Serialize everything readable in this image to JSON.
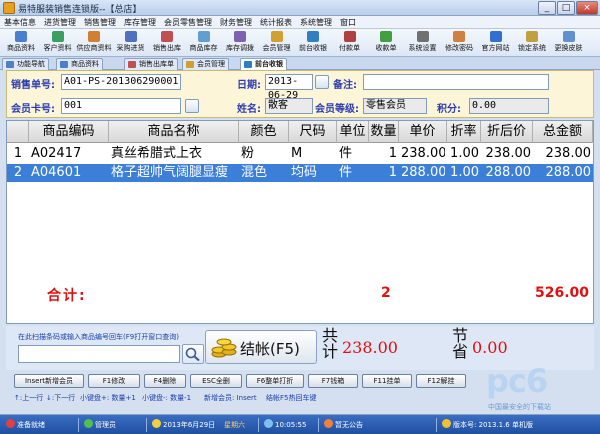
{
  "window": {
    "title": "易特服装销售连锁版--【总店】",
    "min": "_",
    "max": "□",
    "close": "×"
  },
  "menu": [
    "基本信息",
    "进货管理",
    "销售管理",
    "库存管理",
    "会员零售管理",
    "财务管理",
    "统计报表",
    "系统管理",
    "窗口"
  ],
  "toolbar": [
    {
      "label": "商品资料",
      "icon": "product-icon",
      "color": "#4a7fd0"
    },
    {
      "label": "客户资料",
      "icon": "customer-icon",
      "color": "#3aa060"
    },
    {
      "label": "供应商资料",
      "icon": "supplier-icon",
      "color": "#d08030"
    },
    {
      "label": "采购进货",
      "icon": "purchase-icon",
      "color": "#5070c0"
    },
    {
      "label": "销售出库",
      "icon": "sales-out-icon",
      "color": "#c05050"
    },
    {
      "label": "商品库存",
      "icon": "inventory-icon",
      "color": "#60a0d0"
    },
    {
      "label": "库存调拨",
      "icon": "transfer-icon",
      "color": "#8060b0"
    },
    {
      "label": "会员管理",
      "icon": "member-icon",
      "color": "#d0a030"
    },
    {
      "label": "前台收银",
      "icon": "cashier-icon",
      "color": "#3080c0"
    },
    {
      "label": "付款单",
      "icon": "payment-icon",
      "color": "#b04040"
    },
    {
      "label": "收款单",
      "icon": "receipt-icon",
      "color": "#40a040"
    },
    {
      "label": "系统设置",
      "icon": "settings-icon",
      "color": "#707070"
    },
    {
      "label": "修改密码",
      "icon": "password-icon",
      "color": "#d08040"
    },
    {
      "label": "官方网站",
      "icon": "website-icon",
      "color": "#3070d0"
    },
    {
      "label": "锁定系统",
      "icon": "lock-icon",
      "color": "#c0a040"
    },
    {
      "label": "更换皮肤",
      "icon": "skin-icon",
      "color": "#6090d0"
    }
  ],
  "tabs": [
    {
      "label": "功能导航",
      "active": false,
      "color": "#5080c0"
    },
    {
      "label": "商品资料",
      "active": false,
      "color": "#4a7fd0"
    },
    {
      "label": "销售出库单",
      "active": false,
      "color": "#c05050"
    },
    {
      "label": "会员管理",
      "active": false,
      "color": "#d0a030"
    },
    {
      "label": "前台收银",
      "active": true,
      "color": "#3080c0"
    }
  ],
  "form": {
    "order_no_label": "销售单号:",
    "order_no": "A01-PS-201306290001",
    "date_label": "日期:",
    "date": "2013-06-29",
    "remark_label": "备注:",
    "remark": "",
    "member_no_label": "会员卡号:",
    "member_no": "001",
    "name_label": "姓名:",
    "name": "散客",
    "level_label": "会员等级:",
    "level": "零售会员",
    "points_label": "积分:",
    "points": "0.00"
  },
  "grid": {
    "headers": [
      "商品编码",
      "商品名称",
      "颜色",
      "尺码",
      "单位",
      "数量",
      "单价",
      "折率",
      "折后价",
      "总金额"
    ],
    "rows": [
      {
        "no": "1",
        "code": "A02417",
        "name": "真丝希腊式上衣",
        "color": "粉",
        "size": "M",
        "unit": "件",
        "qty": "1",
        "price": "238.00",
        "rate": "1.00",
        "after": "238.00",
        "amount": "238.00",
        "selected": false
      },
      {
        "no": "2",
        "code": "A04601",
        "name": "格子超帅气阔腿显瘦",
        "color": "混色",
        "size": "均码",
        "unit": "件",
        "qty": "1",
        "price": "288.00",
        "rate": "1.00",
        "after": "288.00",
        "amount": "288.00",
        "selected": true
      }
    ],
    "total_label": "合计:",
    "total_qty": "2",
    "total_amount": "526.00"
  },
  "bottom": {
    "scan_hint": "在此扫描条码或输入商品编号回车(F9打开窗口查询)",
    "checkout_label": "结帐(F5)",
    "sum_label": "共计",
    "sum_value": "238.00",
    "save_label": "节省",
    "save_value": "0.00"
  },
  "fkeys": [
    "Insert新增会员",
    "F1修改",
    "F4删除",
    "ESC全删",
    "F6整单打折",
    "F7钱箱",
    "F11挂单",
    "F12解挂"
  ],
  "hints": [
    "↑:上一行",
    "↓:下一行",
    "小键盘+: 数量+1",
    "小键盘-: 数量-1",
    "新增会员: Insert",
    "结帐F5热回车键"
  ],
  "watermark": {
    "text": "pc6",
    "sub": "中国最安全的下载站"
  },
  "status": {
    "ready": "准备就绪",
    "user": "管理员",
    "date": "2013年6月29日",
    "weekday": "星期六",
    "time": "10:05:55",
    "notice": "暂无公告",
    "version": "版本号: 2013.1.6 单机版"
  }
}
